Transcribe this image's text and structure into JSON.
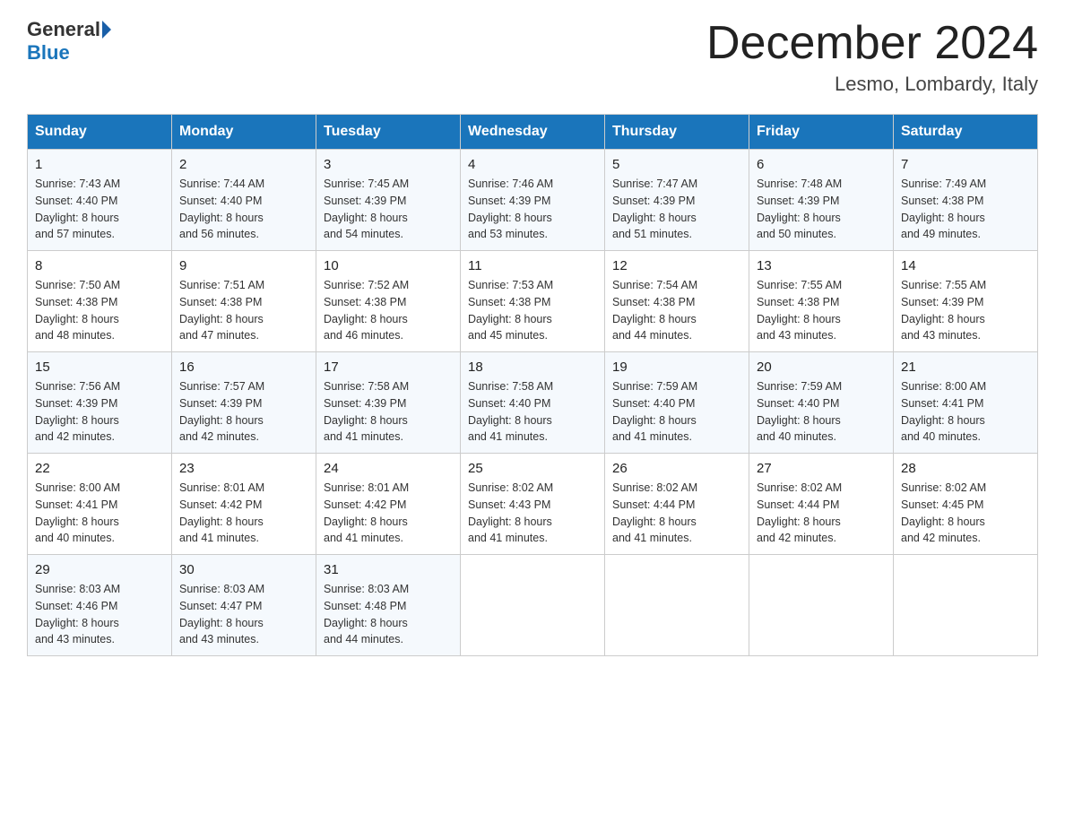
{
  "logo": {
    "general": "General",
    "blue": "Blue"
  },
  "title": "December 2024",
  "location": "Lesmo, Lombardy, Italy",
  "days_of_week": [
    "Sunday",
    "Monday",
    "Tuesday",
    "Wednesday",
    "Thursday",
    "Friday",
    "Saturday"
  ],
  "weeks": [
    [
      {
        "day": "1",
        "sunrise": "7:43 AM",
        "sunset": "4:40 PM",
        "daylight": "8 hours and 57 minutes."
      },
      {
        "day": "2",
        "sunrise": "7:44 AM",
        "sunset": "4:40 PM",
        "daylight": "8 hours and 56 minutes."
      },
      {
        "day": "3",
        "sunrise": "7:45 AM",
        "sunset": "4:39 PM",
        "daylight": "8 hours and 54 minutes."
      },
      {
        "day": "4",
        "sunrise": "7:46 AM",
        "sunset": "4:39 PM",
        "daylight": "8 hours and 53 minutes."
      },
      {
        "day": "5",
        "sunrise": "7:47 AM",
        "sunset": "4:39 PM",
        "daylight": "8 hours and 51 minutes."
      },
      {
        "day": "6",
        "sunrise": "7:48 AM",
        "sunset": "4:39 PM",
        "daylight": "8 hours and 50 minutes."
      },
      {
        "day": "7",
        "sunrise": "7:49 AM",
        "sunset": "4:38 PM",
        "daylight": "8 hours and 49 minutes."
      }
    ],
    [
      {
        "day": "8",
        "sunrise": "7:50 AM",
        "sunset": "4:38 PM",
        "daylight": "8 hours and 48 minutes."
      },
      {
        "day": "9",
        "sunrise": "7:51 AM",
        "sunset": "4:38 PM",
        "daylight": "8 hours and 47 minutes."
      },
      {
        "day": "10",
        "sunrise": "7:52 AM",
        "sunset": "4:38 PM",
        "daylight": "8 hours and 46 minutes."
      },
      {
        "day": "11",
        "sunrise": "7:53 AM",
        "sunset": "4:38 PM",
        "daylight": "8 hours and 45 minutes."
      },
      {
        "day": "12",
        "sunrise": "7:54 AM",
        "sunset": "4:38 PM",
        "daylight": "8 hours and 44 minutes."
      },
      {
        "day": "13",
        "sunrise": "7:55 AM",
        "sunset": "4:38 PM",
        "daylight": "8 hours and 43 minutes."
      },
      {
        "day": "14",
        "sunrise": "7:55 AM",
        "sunset": "4:39 PM",
        "daylight": "8 hours and 43 minutes."
      }
    ],
    [
      {
        "day": "15",
        "sunrise": "7:56 AM",
        "sunset": "4:39 PM",
        "daylight": "8 hours and 42 minutes."
      },
      {
        "day": "16",
        "sunrise": "7:57 AM",
        "sunset": "4:39 PM",
        "daylight": "8 hours and 42 minutes."
      },
      {
        "day": "17",
        "sunrise": "7:58 AM",
        "sunset": "4:39 PM",
        "daylight": "8 hours and 41 minutes."
      },
      {
        "day": "18",
        "sunrise": "7:58 AM",
        "sunset": "4:40 PM",
        "daylight": "8 hours and 41 minutes."
      },
      {
        "day": "19",
        "sunrise": "7:59 AM",
        "sunset": "4:40 PM",
        "daylight": "8 hours and 41 minutes."
      },
      {
        "day": "20",
        "sunrise": "7:59 AM",
        "sunset": "4:40 PM",
        "daylight": "8 hours and 40 minutes."
      },
      {
        "day": "21",
        "sunrise": "8:00 AM",
        "sunset": "4:41 PM",
        "daylight": "8 hours and 40 minutes."
      }
    ],
    [
      {
        "day": "22",
        "sunrise": "8:00 AM",
        "sunset": "4:41 PM",
        "daylight": "8 hours and 40 minutes."
      },
      {
        "day": "23",
        "sunrise": "8:01 AM",
        "sunset": "4:42 PM",
        "daylight": "8 hours and 41 minutes."
      },
      {
        "day": "24",
        "sunrise": "8:01 AM",
        "sunset": "4:42 PM",
        "daylight": "8 hours and 41 minutes."
      },
      {
        "day": "25",
        "sunrise": "8:02 AM",
        "sunset": "4:43 PM",
        "daylight": "8 hours and 41 minutes."
      },
      {
        "day": "26",
        "sunrise": "8:02 AM",
        "sunset": "4:44 PM",
        "daylight": "8 hours and 41 minutes."
      },
      {
        "day": "27",
        "sunrise": "8:02 AM",
        "sunset": "4:44 PM",
        "daylight": "8 hours and 42 minutes."
      },
      {
        "day": "28",
        "sunrise": "8:02 AM",
        "sunset": "4:45 PM",
        "daylight": "8 hours and 42 minutes."
      }
    ],
    [
      {
        "day": "29",
        "sunrise": "8:03 AM",
        "sunset": "4:46 PM",
        "daylight": "8 hours and 43 minutes."
      },
      {
        "day": "30",
        "sunrise": "8:03 AM",
        "sunset": "4:47 PM",
        "daylight": "8 hours and 43 minutes."
      },
      {
        "day": "31",
        "sunrise": "8:03 AM",
        "sunset": "4:48 PM",
        "daylight": "8 hours and 44 minutes."
      },
      null,
      null,
      null,
      null
    ]
  ],
  "labels": {
    "sunrise": "Sunrise:",
    "sunset": "Sunset:",
    "daylight": "Daylight:"
  }
}
